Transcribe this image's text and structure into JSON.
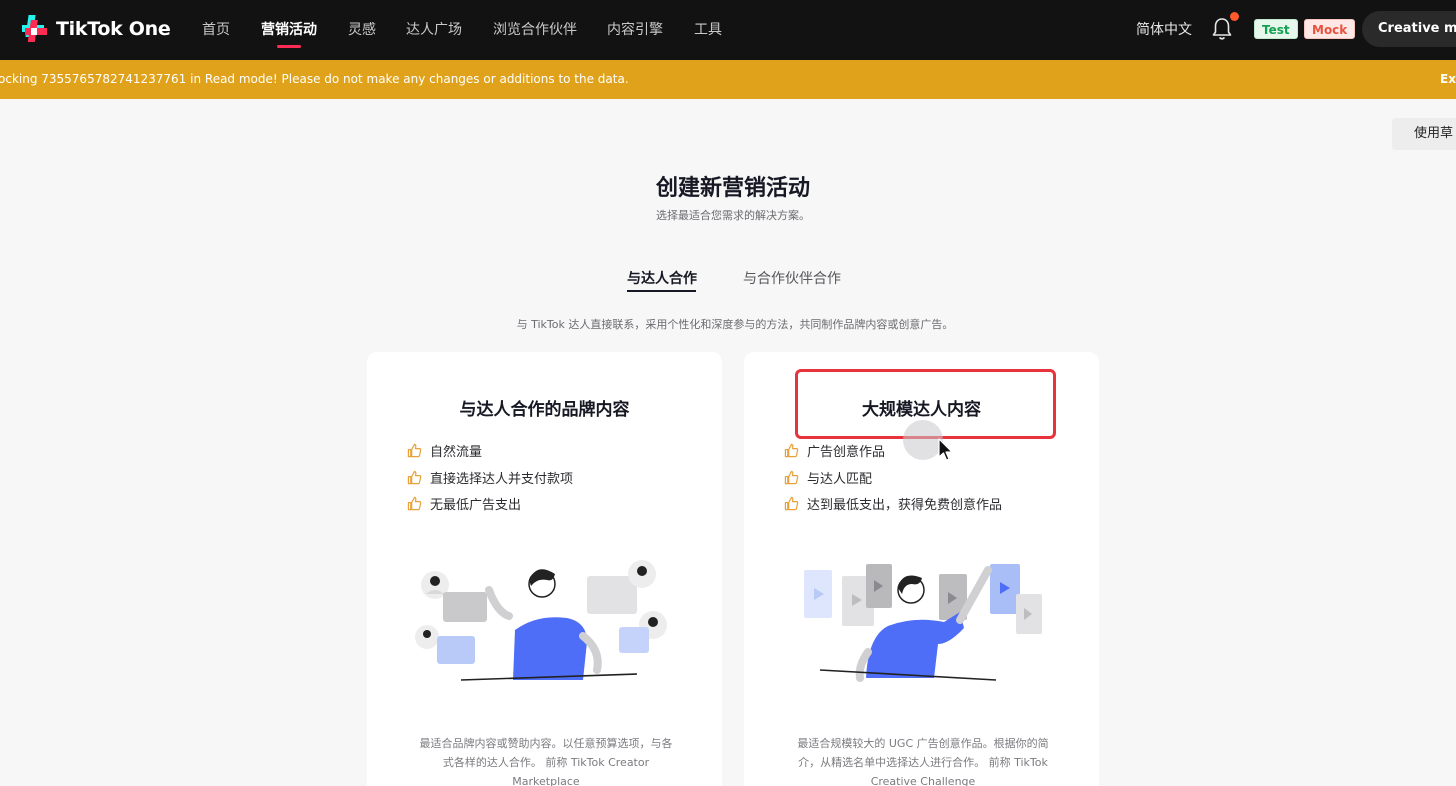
{
  "app": {
    "logo_text": "TikTok One"
  },
  "nav": {
    "items": [
      {
        "label": "首页"
      },
      {
        "label": "营销活动"
      },
      {
        "label": "灵感"
      },
      {
        "label": "达人广场"
      },
      {
        "label": "浏览合作伙伴"
      },
      {
        "label": "内容引擎"
      },
      {
        "label": "工具"
      }
    ],
    "active_index": 1,
    "language": "简体中文",
    "chip_test": "Test",
    "chip_mock": "Mock",
    "account": "Creative main..."
  },
  "banner": {
    "text": "ocking 7355765782741237761 in Read mode! Please do not make any changes or additions to the data.",
    "exit": "Exi",
    "color": "#e0a21a"
  },
  "side_button": {
    "label": "使用草"
  },
  "header": {
    "title": "创建新营销活动",
    "subtitle": "选择最适合您需求的解决方案。"
  },
  "tabs": [
    {
      "label": "与达人合作",
      "active": true
    },
    {
      "label": "与合作伙伴合作",
      "active": false
    }
  ],
  "description": "与 TikTok 达人直接联系，采用个性化和深度参与的方法，共同制作品牌内容或创意广告。",
  "cards": [
    {
      "title": "与达人合作的品牌内容",
      "features": [
        "自然流量",
        "直接选择达人并支付款项",
        "无最低广告支出"
      ],
      "desc_lines": [
        "最适合品牌内容或赞助内容。以任意预算选项，与各",
        "式各样的达人合作。 前称 TikTok Creator",
        "Marketplace"
      ]
    },
    {
      "title": "大规模达人内容",
      "features": [
        "广告创意作品",
        "与达人匹配",
        "达到最低支出，获得免费创意作品"
      ],
      "desc_lines": [
        "最适合规模较大的 UGC 广告创意作品。根据你的简",
        "介，从精选名单中选择达人进行合作。 前称 TikTok",
        "Creative Challenge"
      ]
    }
  ],
  "colors": {
    "accent": "#fe2c55",
    "thumb_icon": "#e9a23b",
    "highlight": "#e8323c",
    "figure_shirt": "#4f6ef7"
  },
  "icons": {
    "feature": "thumbs-up-icon",
    "bell": "bell-icon",
    "cursor": "mouse-cursor-icon"
  }
}
